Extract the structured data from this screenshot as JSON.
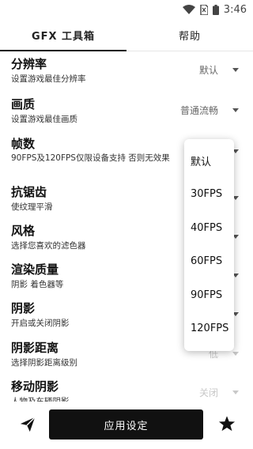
{
  "status_bar": {
    "time": "3:46",
    "icons": [
      "wifi-icon",
      "sim-icon",
      "battery-icon"
    ]
  },
  "tabs": [
    {
      "label": "GFX 工具箱",
      "active": true
    },
    {
      "label": "帮助",
      "active": false
    }
  ],
  "settings": [
    {
      "title": "分辨率",
      "subtitle": "设置游戏最佳分辨率",
      "value": "默认"
    },
    {
      "title": "画质",
      "subtitle": "设置游戏最佳画质",
      "value": "普通流畅"
    },
    {
      "title": "帧数",
      "subtitle": "90FPS及120FPS仅限设备支持 否则无效果",
      "value": ""
    },
    {
      "title": "抗锯齿",
      "subtitle": "使纹理平滑",
      "value": ""
    },
    {
      "title": "风格",
      "subtitle": "选择您喜欢的滤色器",
      "value": ""
    },
    {
      "title": "渲染质量",
      "subtitle": "阴影 着色器等",
      "value": ""
    },
    {
      "title": "阴影",
      "subtitle": "开启或关闭阴影",
      "value": ""
    },
    {
      "title": "阴影距离",
      "subtitle": "选择阴影距离级别",
      "value": "低"
    },
    {
      "title": "移动阴影",
      "subtitle": "人物及车辆阴影",
      "value": "关闭"
    }
  ],
  "fps_dropdown": {
    "options": [
      "默认",
      "30FPS",
      "40FPS",
      "60FPS",
      "90FPS",
      "120FPS"
    ]
  },
  "bottom_bar": {
    "apply_label": "应用设定",
    "left_icon": "send-icon",
    "right_icon": "star-icon"
  },
  "colors": {
    "primary": "#111111",
    "background": "#ffffff",
    "muted_text": "#666666",
    "disabled_text": "#c8c8c8"
  }
}
